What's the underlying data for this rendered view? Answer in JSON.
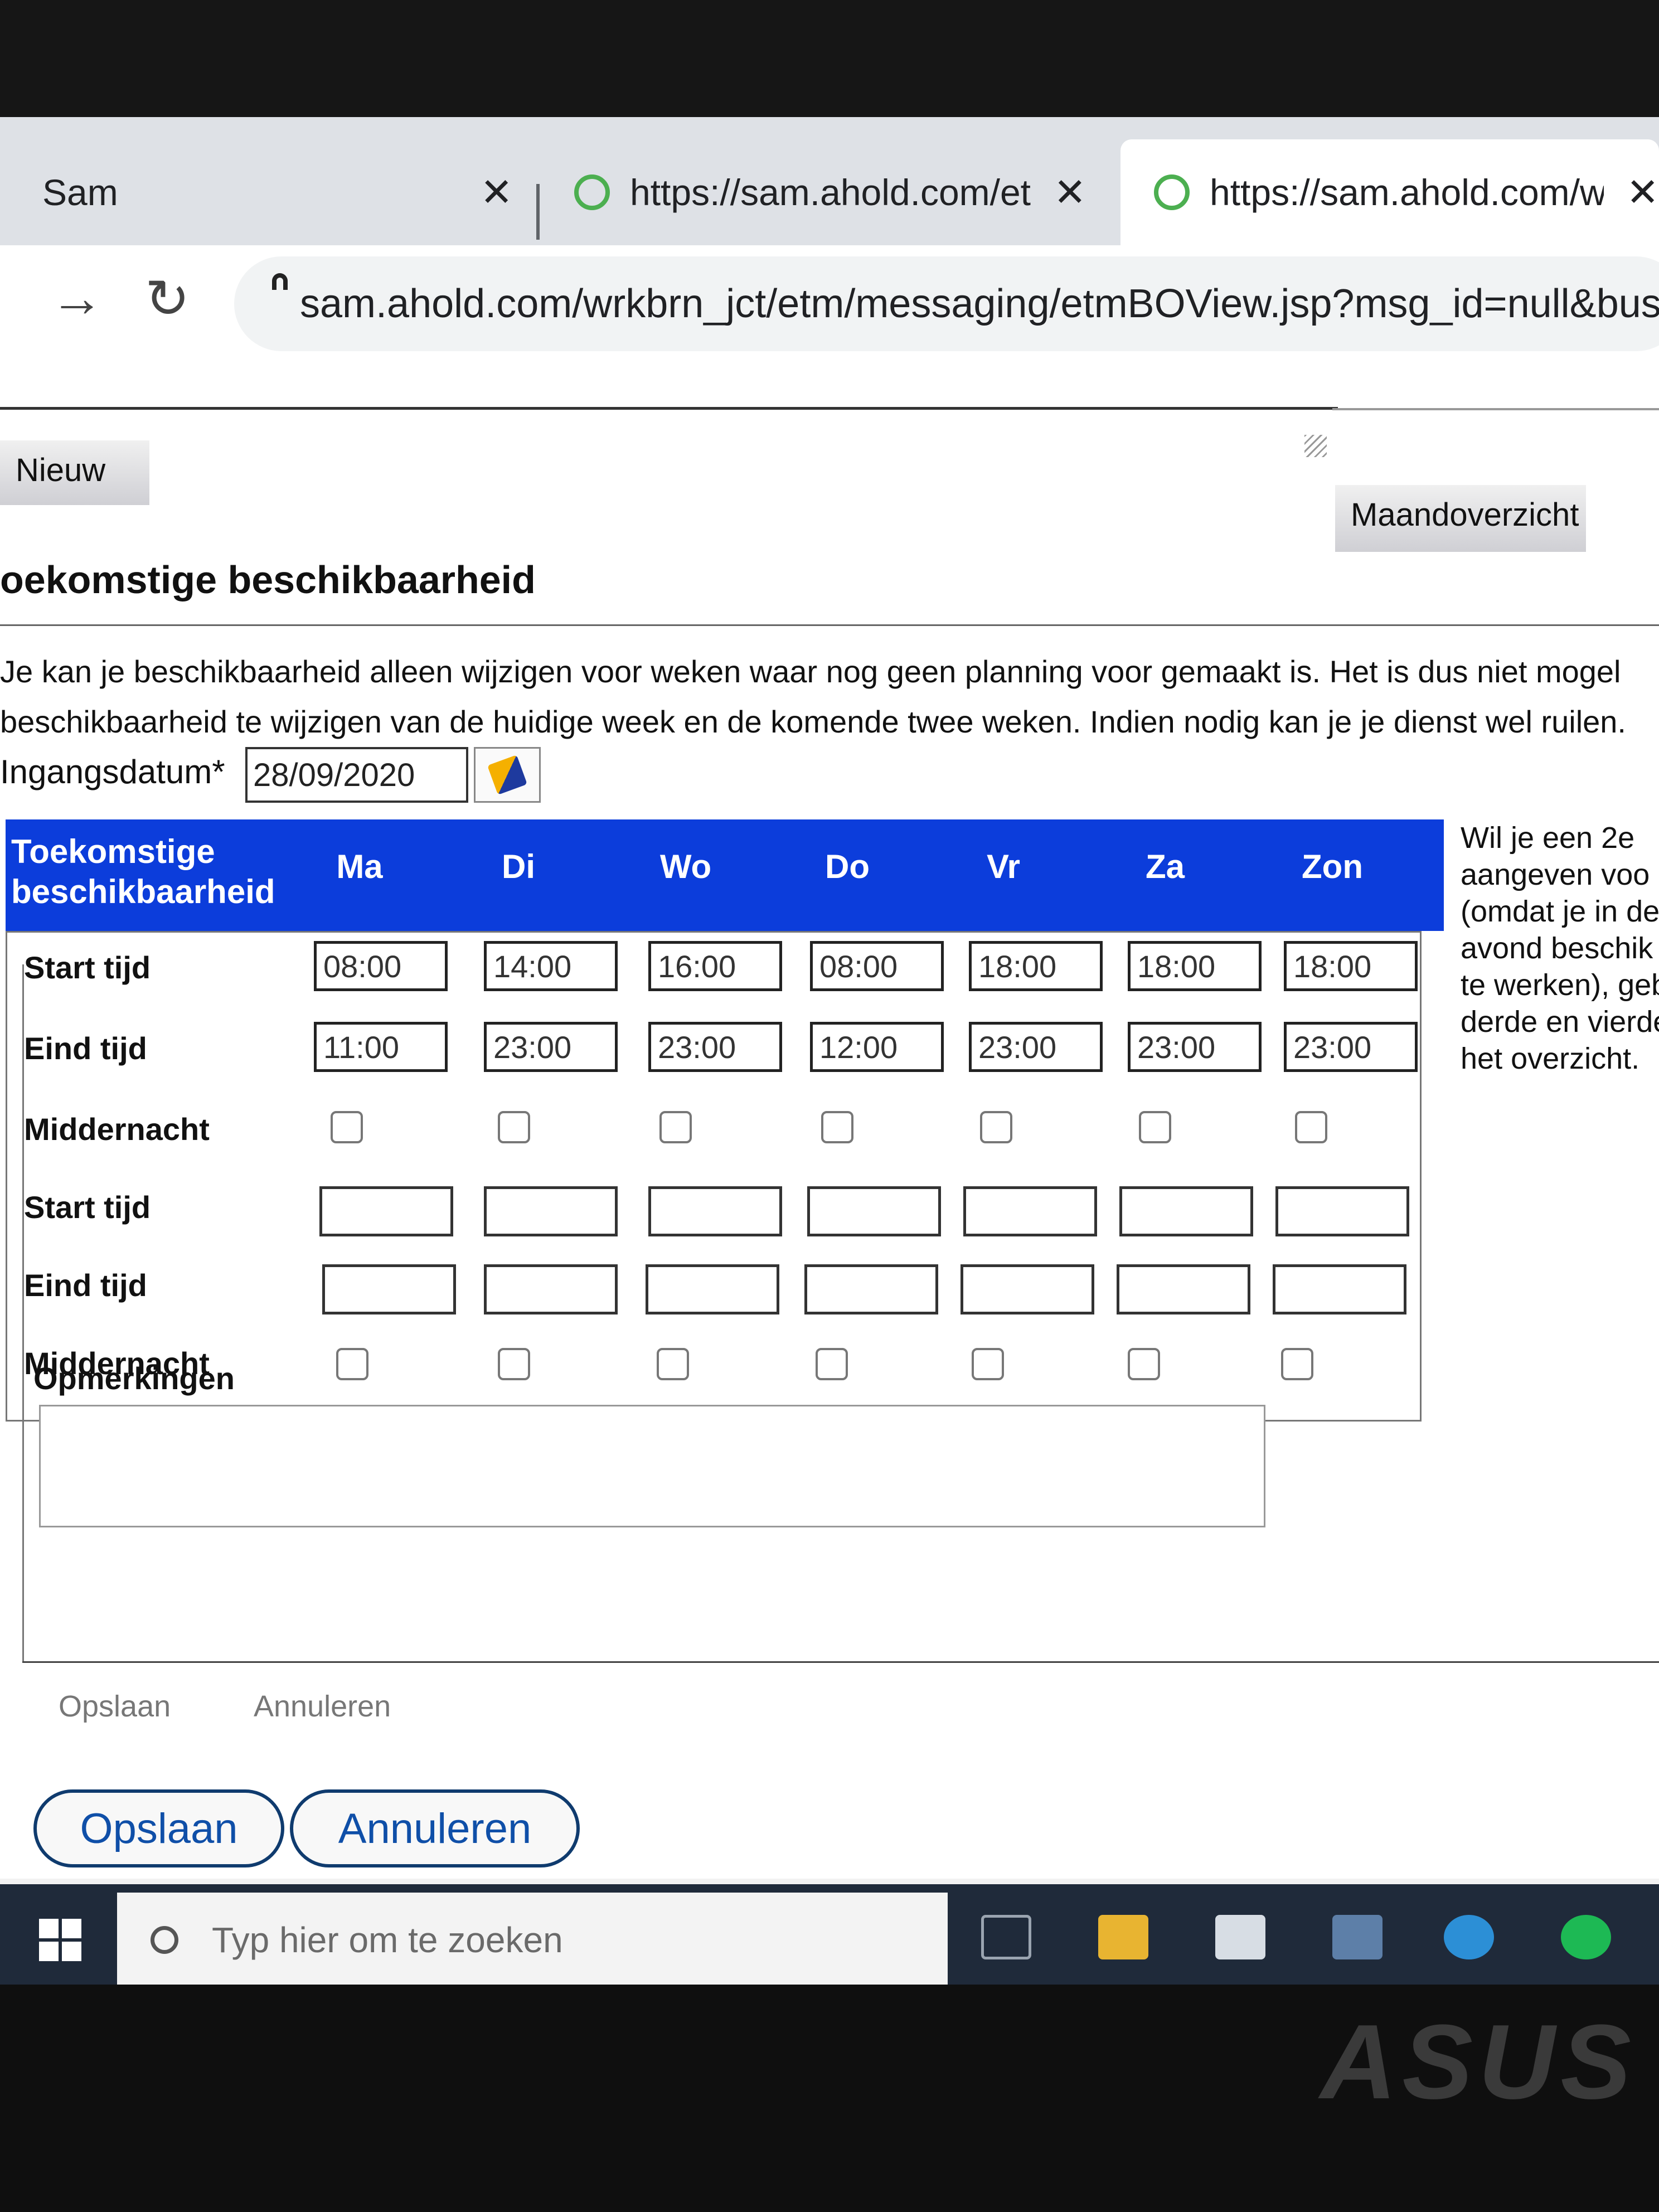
{
  "browser": {
    "tabs": [
      {
        "label": "Sam",
        "active": false
      },
      {
        "label": "https://sam.ahold.com/etm",
        "active": false
      },
      {
        "label": "https://sam.ahold.com/wrk",
        "active": true
      }
    ],
    "close_glyph": "✕",
    "url": "sam.ahold.com/wrkbrn_jct/etm/messaging/etmBOView.jsp?msg_id=null&busO"
  },
  "page": {
    "new_button": "Nieuw",
    "month_button": "Maandoverzicht",
    "title": "oekomstige beschikbaarheid",
    "info_lines": [
      "Je kan je beschikbaarheid alleen wijzigen voor weken waar nog geen planning voor gemaakt is. Het is dus niet mogel",
      "beschikbaarheid te wijzigen van de huidige week en de komende twee weken. Indien nodig kan je je dienst wel ruilen."
    ],
    "start_date_label": "Ingangsdatum*",
    "start_date_value": "28/09/2020",
    "table": {
      "corner_line1": "Toekomstige",
      "corner_line2": "beschikbaarheid",
      "days": [
        "Ma",
        "Di",
        "Wo",
        "Do",
        "Vr",
        "Za",
        "Zon"
      ],
      "row_labels": {
        "start1": "Start tijd",
        "end1": "Eind tijd",
        "midnight1": "Middernacht",
        "start2": "Start tijd",
        "end2": "Eind tijd",
        "midnight2": "Middernacht"
      },
      "start_times": [
        "08:00",
        "14:00",
        "16:00",
        "08:00",
        "18:00",
        "18:00",
        "18:00"
      ],
      "end_times": [
        "11:00",
        "23:00",
        "23:00",
        "12:00",
        "23:00",
        "23:00",
        "23:00"
      ]
    },
    "side_note_lines": [
      "Wil je een 2e",
      "aangeven voo",
      "(omdat je in de",
      "avond beschik",
      "te werken), geb",
      "derde en vierde",
      "het overzicht."
    ],
    "remarks_label": "Opmerkingen",
    "save_link": "Opslaan",
    "cancel_link": "Annuleren",
    "save_button": "Opslaan",
    "cancel_button": "Annuleren"
  },
  "taskbar": {
    "search_placeholder": "Typ hier om te zoeken"
  },
  "monitor": {
    "brand": "ASUS"
  },
  "colors": {
    "header_blue": "#0c3ddb",
    "pill_text": "#0f4fa8",
    "taskbar": "#1f2a3a"
  }
}
